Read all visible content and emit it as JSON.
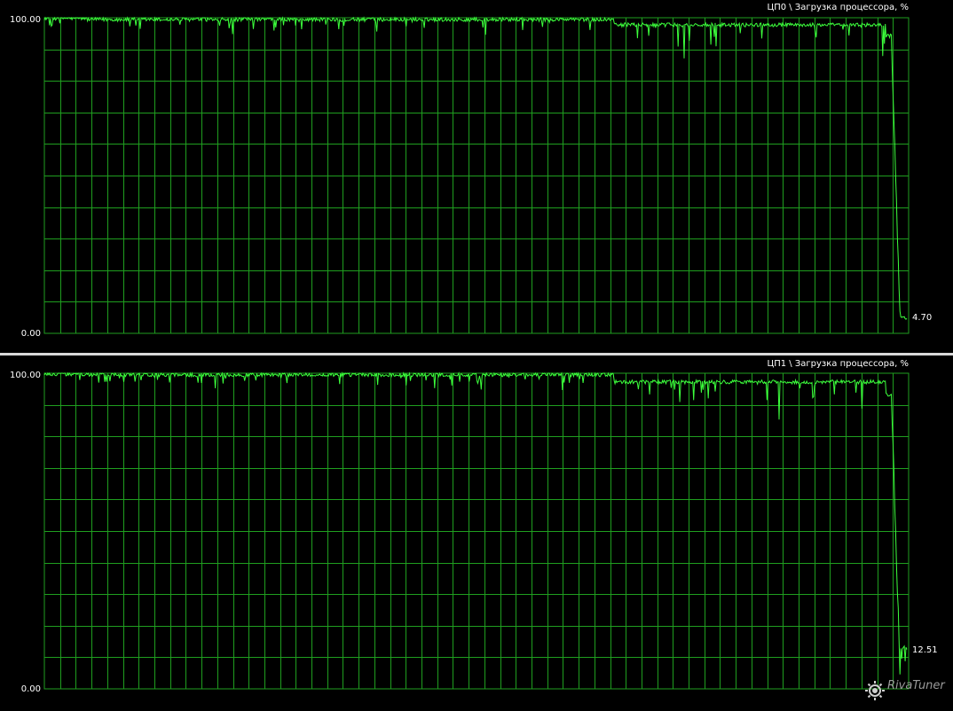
{
  "colors": {
    "background": "#000000",
    "grid": "#1f9e1f",
    "line": "#3cff3c",
    "text": "#ffffff",
    "separator": "#d9d9d9"
  },
  "chart_data": [
    {
      "type": "line",
      "title": "ЦП0 \\ Загрузка процессора, %",
      "ylim": [
        0,
        100
      ],
      "y_tick_labels": [
        "100.00",
        "0.00"
      ],
      "last_value_label": "4.70",
      "grid": true,
      "samples": 1000,
      "segments": [
        {
          "from": 0.0,
          "to": 0.05,
          "avg": 99.6,
          "dip": 2.5
        },
        {
          "from": 0.05,
          "to": 0.66,
          "avg": 99.2,
          "dip": 3.5
        },
        {
          "from": 0.66,
          "to": 0.975,
          "avg": 97.5,
          "dip": 7.5
        },
        {
          "from": 0.975,
          "to": 0.982,
          "avg": 94,
          "dip": 6
        },
        {
          "from": 0.982,
          "to": 0.992,
          "avg": 50,
          "dip": 40
        },
        {
          "from": 0.992,
          "to": 1.0,
          "avg": 4.7,
          "dip": 4
        }
      ],
      "final_value": 4.7
    },
    {
      "type": "line",
      "title": "ЦП1 \\ Загрузка процессора, %",
      "ylim": [
        0,
        100
      ],
      "y_tick_labels": [
        "100.00",
        "0.00"
      ],
      "last_value_label": "12.51",
      "grid": true,
      "samples": 1000,
      "segments": [
        {
          "from": 0.0,
          "to": 0.05,
          "avg": 99.5,
          "dip": 2.5
        },
        {
          "from": 0.05,
          "to": 0.66,
          "avg": 99.3,
          "dip": 3.0
        },
        {
          "from": 0.66,
          "to": 0.975,
          "avg": 97.0,
          "dip": 6.5
        },
        {
          "from": 0.975,
          "to": 0.982,
          "avg": 93,
          "dip": 6
        },
        {
          "from": 0.982,
          "to": 0.992,
          "avg": 50,
          "dip": 40
        },
        {
          "from": 0.992,
          "to": 1.0,
          "avg": 13,
          "dip": 5
        }
      ],
      "final_value": 12.51
    }
  ],
  "watermark": {
    "text": "RivaTuner",
    "icon": "gear-icon"
  }
}
